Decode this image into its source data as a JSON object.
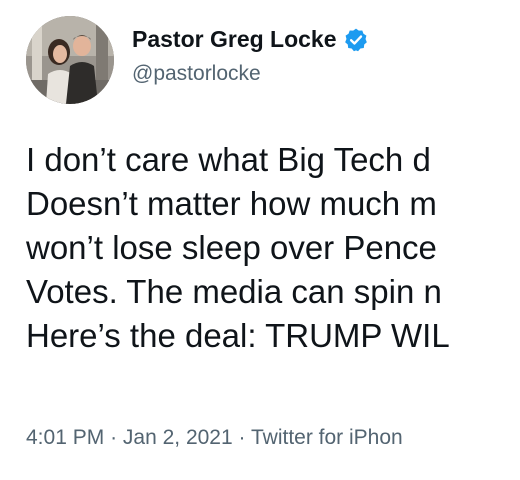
{
  "author": {
    "name": "Pastor Greg Locke",
    "handle": "@pastorlocke",
    "verified_icon": "verified-badge-icon",
    "verified_color": "#1d9bf0"
  },
  "tweet": {
    "lines": [
      "I don’t care what Big Tech d",
      "Doesn’t matter how much m",
      "won’t lose sleep over Pence",
      "Votes. The media can spin n",
      "Here’s the deal: TRUMP WIL"
    ]
  },
  "meta": {
    "time": "4:01 PM",
    "separator": "·",
    "date": "Jan 2, 2021",
    "source": "Twitter for iPhon"
  },
  "colors": {
    "text": "#0f1419",
    "secondary": "#536471",
    "background": "#ffffff"
  }
}
